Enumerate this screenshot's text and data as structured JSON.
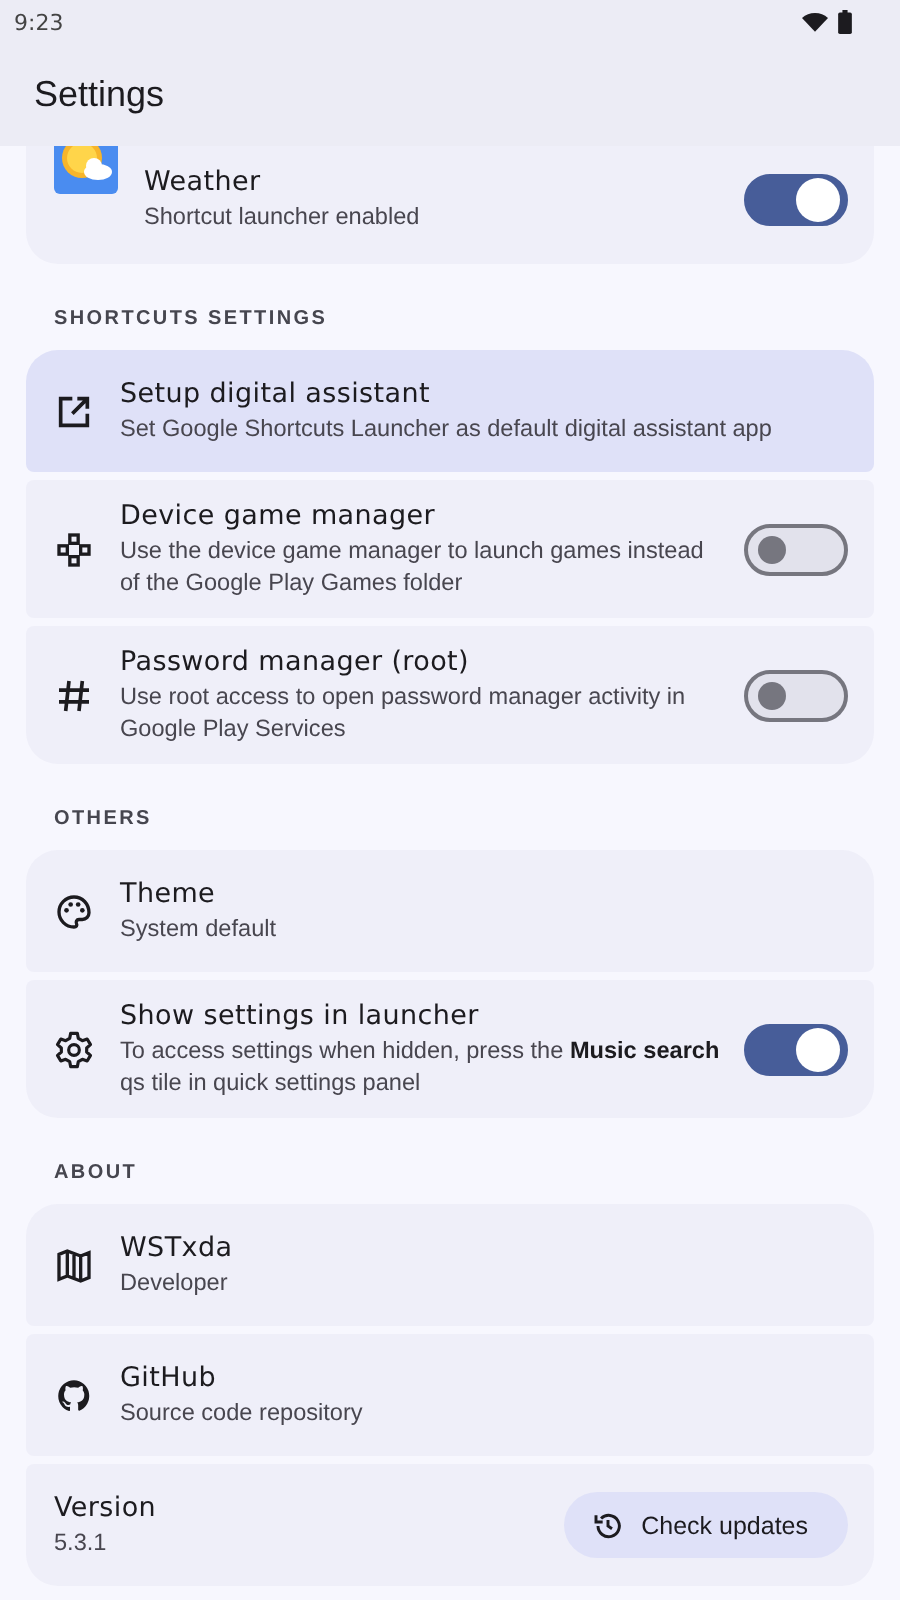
{
  "status_bar": {
    "time": "9:23"
  },
  "app_bar": {
    "title": "Settings"
  },
  "top_item": {
    "title": "Weather",
    "subtitle": "Shortcut launcher enabled",
    "on": true
  },
  "sections": [
    {
      "header": "SHORTCUTS SETTINGS",
      "items": [
        {
          "kind": "link",
          "title": "Setup digital assistant",
          "subtitle": "Set Google Shortcuts Launcher as default digital assistant app",
          "selected": true
        },
        {
          "kind": "toggle",
          "title": "Device game manager",
          "subtitle": "Use the device game manager to launch games instead of the Google Play Games folder",
          "on": false,
          "selected": false
        },
        {
          "kind": "toggle",
          "title": "Password manager (root)",
          "subtitle": "Use root access to open password manager activity in Google Play Services",
          "on": false,
          "selected": false
        }
      ]
    },
    {
      "header": "OTHERS",
      "items": [
        {
          "kind": "link",
          "title": "Theme",
          "subtitle": "System default",
          "selected": false
        },
        {
          "kind": "toggle",
          "title": "Show settings in launcher",
          "subtitle": "To access settings when hidden, press the **Music search** qs tile in quick settings panel",
          "on": true,
          "selected": false
        }
      ]
    },
    {
      "header": "ABOUT",
      "items": [
        {
          "kind": "link",
          "title": "WSTxda",
          "subtitle": "Developer",
          "selected": false
        },
        {
          "kind": "link",
          "title": "GitHub",
          "subtitle": "Source code repository",
          "selected": false
        },
        {
          "kind": "version",
          "title": "Version",
          "subtitle": "5.3.1",
          "button": "Check updates",
          "selected": false
        }
      ]
    }
  ]
}
